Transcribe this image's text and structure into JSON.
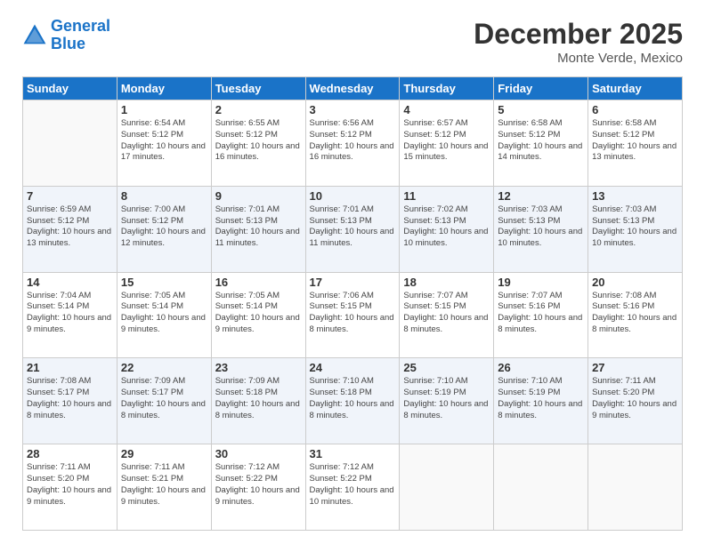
{
  "logo": {
    "line1": "General",
    "line2": "Blue"
  },
  "title": "December 2025",
  "subtitle": "Monte Verde, Mexico",
  "days_of_week": [
    "Sunday",
    "Monday",
    "Tuesday",
    "Wednesday",
    "Thursday",
    "Friday",
    "Saturday"
  ],
  "weeks": [
    [
      {
        "day": "",
        "sunrise": "",
        "sunset": "",
        "daylight": ""
      },
      {
        "day": "1",
        "sunrise": "Sunrise: 6:54 AM",
        "sunset": "Sunset: 5:12 PM",
        "daylight": "Daylight: 10 hours and 17 minutes."
      },
      {
        "day": "2",
        "sunrise": "Sunrise: 6:55 AM",
        "sunset": "Sunset: 5:12 PM",
        "daylight": "Daylight: 10 hours and 16 minutes."
      },
      {
        "day": "3",
        "sunrise": "Sunrise: 6:56 AM",
        "sunset": "Sunset: 5:12 PM",
        "daylight": "Daylight: 10 hours and 16 minutes."
      },
      {
        "day": "4",
        "sunrise": "Sunrise: 6:57 AM",
        "sunset": "Sunset: 5:12 PM",
        "daylight": "Daylight: 10 hours and 15 minutes."
      },
      {
        "day": "5",
        "sunrise": "Sunrise: 6:58 AM",
        "sunset": "Sunset: 5:12 PM",
        "daylight": "Daylight: 10 hours and 14 minutes."
      },
      {
        "day": "6",
        "sunrise": "Sunrise: 6:58 AM",
        "sunset": "Sunset: 5:12 PM",
        "daylight": "Daylight: 10 hours and 13 minutes."
      }
    ],
    [
      {
        "day": "7",
        "sunrise": "Sunrise: 6:59 AM",
        "sunset": "Sunset: 5:12 PM",
        "daylight": "Daylight: 10 hours and 13 minutes."
      },
      {
        "day": "8",
        "sunrise": "Sunrise: 7:00 AM",
        "sunset": "Sunset: 5:12 PM",
        "daylight": "Daylight: 10 hours and 12 minutes."
      },
      {
        "day": "9",
        "sunrise": "Sunrise: 7:01 AM",
        "sunset": "Sunset: 5:13 PM",
        "daylight": "Daylight: 10 hours and 11 minutes."
      },
      {
        "day": "10",
        "sunrise": "Sunrise: 7:01 AM",
        "sunset": "Sunset: 5:13 PM",
        "daylight": "Daylight: 10 hours and 11 minutes."
      },
      {
        "day": "11",
        "sunrise": "Sunrise: 7:02 AM",
        "sunset": "Sunset: 5:13 PM",
        "daylight": "Daylight: 10 hours and 10 minutes."
      },
      {
        "day": "12",
        "sunrise": "Sunrise: 7:03 AM",
        "sunset": "Sunset: 5:13 PM",
        "daylight": "Daylight: 10 hours and 10 minutes."
      },
      {
        "day": "13",
        "sunrise": "Sunrise: 7:03 AM",
        "sunset": "Sunset: 5:13 PM",
        "daylight": "Daylight: 10 hours and 10 minutes."
      }
    ],
    [
      {
        "day": "14",
        "sunrise": "Sunrise: 7:04 AM",
        "sunset": "Sunset: 5:14 PM",
        "daylight": "Daylight: 10 hours and 9 minutes."
      },
      {
        "day": "15",
        "sunrise": "Sunrise: 7:05 AM",
        "sunset": "Sunset: 5:14 PM",
        "daylight": "Daylight: 10 hours and 9 minutes."
      },
      {
        "day": "16",
        "sunrise": "Sunrise: 7:05 AM",
        "sunset": "Sunset: 5:14 PM",
        "daylight": "Daylight: 10 hours and 9 minutes."
      },
      {
        "day": "17",
        "sunrise": "Sunrise: 7:06 AM",
        "sunset": "Sunset: 5:15 PM",
        "daylight": "Daylight: 10 hours and 8 minutes."
      },
      {
        "day": "18",
        "sunrise": "Sunrise: 7:07 AM",
        "sunset": "Sunset: 5:15 PM",
        "daylight": "Daylight: 10 hours and 8 minutes."
      },
      {
        "day": "19",
        "sunrise": "Sunrise: 7:07 AM",
        "sunset": "Sunset: 5:16 PM",
        "daylight": "Daylight: 10 hours and 8 minutes."
      },
      {
        "day": "20",
        "sunrise": "Sunrise: 7:08 AM",
        "sunset": "Sunset: 5:16 PM",
        "daylight": "Daylight: 10 hours and 8 minutes."
      }
    ],
    [
      {
        "day": "21",
        "sunrise": "Sunrise: 7:08 AM",
        "sunset": "Sunset: 5:17 PM",
        "daylight": "Daylight: 10 hours and 8 minutes."
      },
      {
        "day": "22",
        "sunrise": "Sunrise: 7:09 AM",
        "sunset": "Sunset: 5:17 PM",
        "daylight": "Daylight: 10 hours and 8 minutes."
      },
      {
        "day": "23",
        "sunrise": "Sunrise: 7:09 AM",
        "sunset": "Sunset: 5:18 PM",
        "daylight": "Daylight: 10 hours and 8 minutes."
      },
      {
        "day": "24",
        "sunrise": "Sunrise: 7:10 AM",
        "sunset": "Sunset: 5:18 PM",
        "daylight": "Daylight: 10 hours and 8 minutes."
      },
      {
        "day": "25",
        "sunrise": "Sunrise: 7:10 AM",
        "sunset": "Sunset: 5:19 PM",
        "daylight": "Daylight: 10 hours and 8 minutes."
      },
      {
        "day": "26",
        "sunrise": "Sunrise: 7:10 AM",
        "sunset": "Sunset: 5:19 PM",
        "daylight": "Daylight: 10 hours and 8 minutes."
      },
      {
        "day": "27",
        "sunrise": "Sunrise: 7:11 AM",
        "sunset": "Sunset: 5:20 PM",
        "daylight": "Daylight: 10 hours and 9 minutes."
      }
    ],
    [
      {
        "day": "28",
        "sunrise": "Sunrise: 7:11 AM",
        "sunset": "Sunset: 5:20 PM",
        "daylight": "Daylight: 10 hours and 9 minutes."
      },
      {
        "day": "29",
        "sunrise": "Sunrise: 7:11 AM",
        "sunset": "Sunset: 5:21 PM",
        "daylight": "Daylight: 10 hours and 9 minutes."
      },
      {
        "day": "30",
        "sunrise": "Sunrise: 7:12 AM",
        "sunset": "Sunset: 5:22 PM",
        "daylight": "Daylight: 10 hours and 9 minutes."
      },
      {
        "day": "31",
        "sunrise": "Sunrise: 7:12 AM",
        "sunset": "Sunset: 5:22 PM",
        "daylight": "Daylight: 10 hours and 10 minutes."
      },
      {
        "day": "",
        "sunrise": "",
        "sunset": "",
        "daylight": ""
      },
      {
        "day": "",
        "sunrise": "",
        "sunset": "",
        "daylight": ""
      },
      {
        "day": "",
        "sunrise": "",
        "sunset": "",
        "daylight": ""
      }
    ]
  ]
}
